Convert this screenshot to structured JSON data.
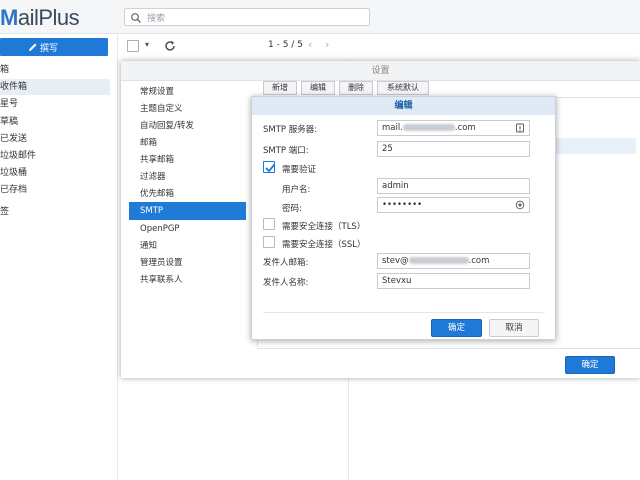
{
  "app": {
    "logo_main": "M",
    "logo_rest": "ailPlus"
  },
  "search": {
    "placeholder": "搜索"
  },
  "sidebar": {
    "compose_label": "撰写",
    "items": [
      {
        "label": "箱"
      },
      {
        "label": "收件箱"
      },
      {
        "label": "星号"
      },
      {
        "label": "草稿"
      },
      {
        "label": "已发送"
      },
      {
        "label": "垃圾邮件"
      },
      {
        "label": "垃圾桶"
      },
      {
        "label": "已存档"
      },
      {
        "label": "签"
      }
    ]
  },
  "toolbar": {
    "pager": "1 - 5 / 5"
  },
  "settings": {
    "title": "设置",
    "nav": [
      "常规设置",
      "主题自定义",
      "自动回复/转发",
      "邮箱",
      "共享邮箱",
      "过滤器",
      "优先邮箱",
      "SMTP",
      "OpenPGP",
      "通知",
      "管理员设置",
      "共享联系人"
    ],
    "active_nav": "SMTP",
    "buttons": {
      "add": "新增",
      "edit": "编辑",
      "delete": "删除",
      "default": "系统默认"
    },
    "ok": "确定"
  },
  "dialog": {
    "title": "编辑",
    "smtp_server_label": "SMTP 服务器:",
    "smtp_server_prefix": "mail.",
    "smtp_server_suffix": ".com",
    "smtp_port_label": "SMTP 端口:",
    "smtp_port": "25",
    "auth_label": "需要验证",
    "auth_checked": true,
    "username_label": "用户名:",
    "username": "admin",
    "password_label": "密码:",
    "password": "••••••••",
    "tls_label": "需要安全连接（TLS）",
    "ssl_label": "需要安全连接（SSL）",
    "sender_email_label": "发件人邮箱:",
    "sender_email_prefix": "stev@",
    "sender_email_suffix": ".com",
    "sender_name_label": "发件人名称:",
    "sender_name": "Stevxu",
    "ok": "确定",
    "cancel": "取消"
  },
  "colors": {
    "accent": "#1e7ad6",
    "dialog_header": "#dfeaf6"
  }
}
